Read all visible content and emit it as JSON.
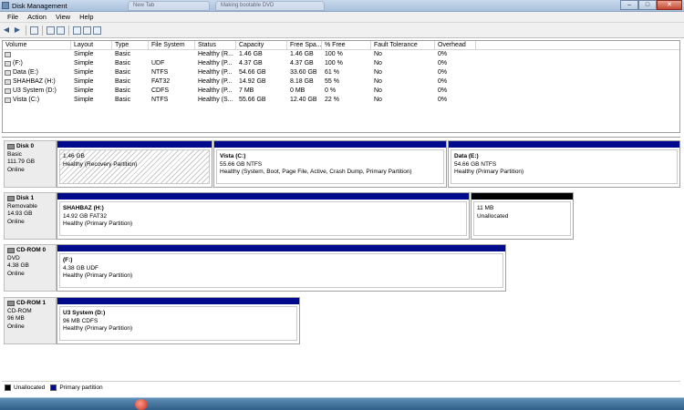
{
  "window": {
    "title": "Disk Management",
    "bg_tabs": [
      "New Tab",
      "Making bootable DVD"
    ]
  },
  "window_buttons": {
    "minimize": "–",
    "maximize": "□",
    "close": "✕"
  },
  "menu": [
    "File",
    "Action",
    "View",
    "Help"
  ],
  "toolbar": {
    "icons": [
      "back-arrow-icon",
      "forward-arrow-icon",
      "console-tree-icon",
      "properties-icon",
      "help-icon",
      "list-icon",
      "refresh-icon",
      "export-icon"
    ]
  },
  "volume_list": {
    "columns": [
      "Volume",
      "Layout",
      "Type",
      "File System",
      "Status",
      "Capacity",
      "Free Spa...",
      "% Free",
      "Fault Tolerance",
      "Overhead"
    ],
    "rows": [
      [
        "",
        "Simple",
        "Basic",
        "",
        "Healthy (R...",
        "1.46 GB",
        "1.46 GB",
        "100 %",
        "No",
        "0%"
      ],
      [
        "(F:)",
        "Simple",
        "Basic",
        "UDF",
        "Healthy (P...",
        "4.37 GB",
        "4.37 GB",
        "100 %",
        "No",
        "0%"
      ],
      [
        "Data (E:)",
        "Simple",
        "Basic",
        "NTFS",
        "Healthy (P...",
        "54.66 GB",
        "33.60 GB",
        "61 %",
        "No",
        "0%"
      ],
      [
        "SHAHBAZ (H:)",
        "Simple",
        "Basic",
        "FAT32",
        "Healthy (P...",
        "14.92 GB",
        "8.18 GB",
        "55 %",
        "No",
        "0%"
      ],
      [
        "U3 System (D:)",
        "Simple",
        "Basic",
        "CDFS",
        "Healthy (P...",
        "7 MB",
        "0 MB",
        "0 %",
        "No",
        "0%"
      ],
      [
        "Vista (C:)",
        "Simple",
        "Basic",
        "NTFS",
        "Healthy (S...",
        "55.66 GB",
        "12.40 GB",
        "22 %",
        "No",
        "0%"
      ]
    ]
  },
  "disks": [
    {
      "name": "Disk 0",
      "type": "Basic",
      "size": "111.79 GB",
      "state": "Online",
      "partitions": [
        {
          "name": "",
          "detail": "1.46 GB",
          "status": "Healthy (Recovery Partition)"
        },
        {
          "name": "Vista  (C:)",
          "detail": "55.66 GB NTFS",
          "status": "Healthy (System, Boot, Page File, Active, Crash Dump, Primary Partition)"
        },
        {
          "name": "Data  (E:)",
          "detail": "54.66 GB NTFS",
          "status": "Healthy (Primary Partition)"
        }
      ]
    },
    {
      "name": "Disk 1",
      "type": "Removable",
      "size": "14.93 GB",
      "state": "Online",
      "partitions": [
        {
          "name": "SHAHBAZ  (H:)",
          "detail": "14.92 GB FAT32",
          "status": "Healthy (Primary Partition)"
        },
        {
          "name": "",
          "detail": "11 MB",
          "status": "Unallocated"
        }
      ]
    },
    {
      "name": "CD-ROM 0",
      "type": "DVD",
      "size": "4.38 GB",
      "state": "Online",
      "partitions": [
        {
          "name": "(F:)",
          "detail": "4.38 GB UDF",
          "status": "Healthy (Primary Partition)"
        }
      ]
    },
    {
      "name": "CD-ROM 1",
      "type": "CD-ROM",
      "size": "96 MB",
      "state": "Online",
      "partitions": [
        {
          "name": "U3 System  (D:)",
          "detail": "96 MB CDFS",
          "status": "Healthy (Primary Partition)"
        }
      ]
    }
  ],
  "legend": {
    "unallocated": "Unallocated",
    "primary": "Primary partition"
  },
  "colors": {
    "primary_partition": "#000a8c",
    "unallocated": "#000000"
  }
}
